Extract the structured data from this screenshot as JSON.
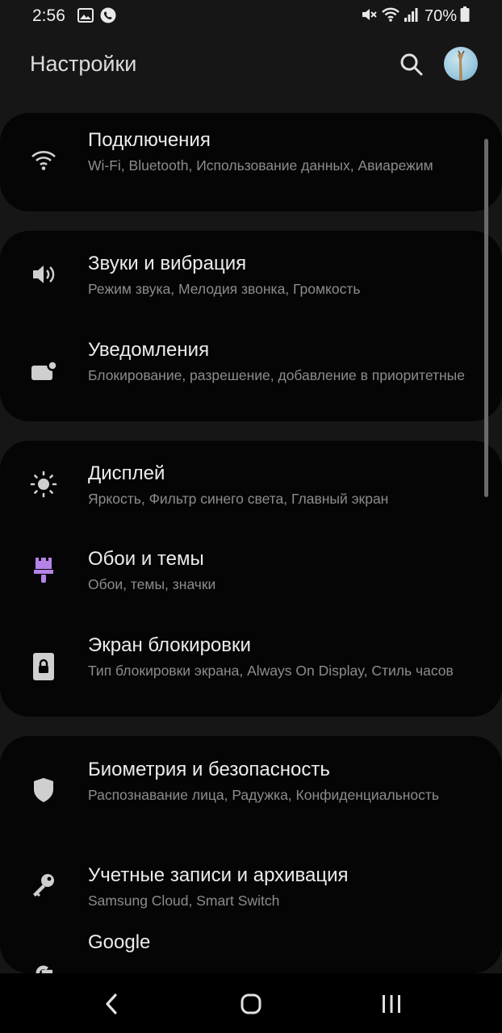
{
  "status_bar": {
    "time": "2:56",
    "battery": "70%",
    "left_icons": [
      "image-icon",
      "phone-call-icon"
    ],
    "right_icons": [
      "mute-icon",
      "wifi-icon",
      "signal-icon",
      "battery-icon"
    ]
  },
  "header": {
    "title": "Настройки",
    "search_icon": "search-icon",
    "avatar": "profile-avatar"
  },
  "items": [
    {
      "icon": "wifi-icon",
      "title": "Подключения",
      "subtitle": "Wi-Fi, Bluetooth, Использование данных, Авиарежим"
    },
    {
      "icon": "volume-icon",
      "title": "Звуки и вибрация",
      "subtitle": "Режим звука, Мелодия звонка, Громкость"
    },
    {
      "icon": "notification-icon",
      "title": "Уведомления",
      "subtitle": "Блокирование, разрешение, добавление в приоритетные"
    },
    {
      "icon": "brightness-icon",
      "title": "Дисплей",
      "subtitle": "Яркость, Фильтр синего света, Главный экран"
    },
    {
      "icon": "paintbrush-icon",
      "title": "Обои и темы",
      "subtitle": "Обои, темы, значки"
    },
    {
      "icon": "lock-icon",
      "title": "Экран блокировки",
      "subtitle": "Тип блокировки экрана, Always On Display, Стиль часов"
    },
    {
      "icon": "shield-icon",
      "title": "Биометрия и безопасность",
      "subtitle": "Распознавание лица, Радужка, Конфиденциальность"
    },
    {
      "icon": "key-icon",
      "title": "Учетные записи и архивация",
      "subtitle": "Samsung Cloud, Smart Switch"
    },
    {
      "icon": "google-icon",
      "title": "Google",
      "subtitle": ""
    }
  ],
  "colors": {
    "background": "#161616",
    "card": "#050505",
    "title_text": "#ececec",
    "subtitle_text": "#8c8c8c",
    "accent_purple": "#b583e6"
  },
  "nav_bar": [
    "back-icon",
    "home-icon",
    "recents-icon"
  ]
}
